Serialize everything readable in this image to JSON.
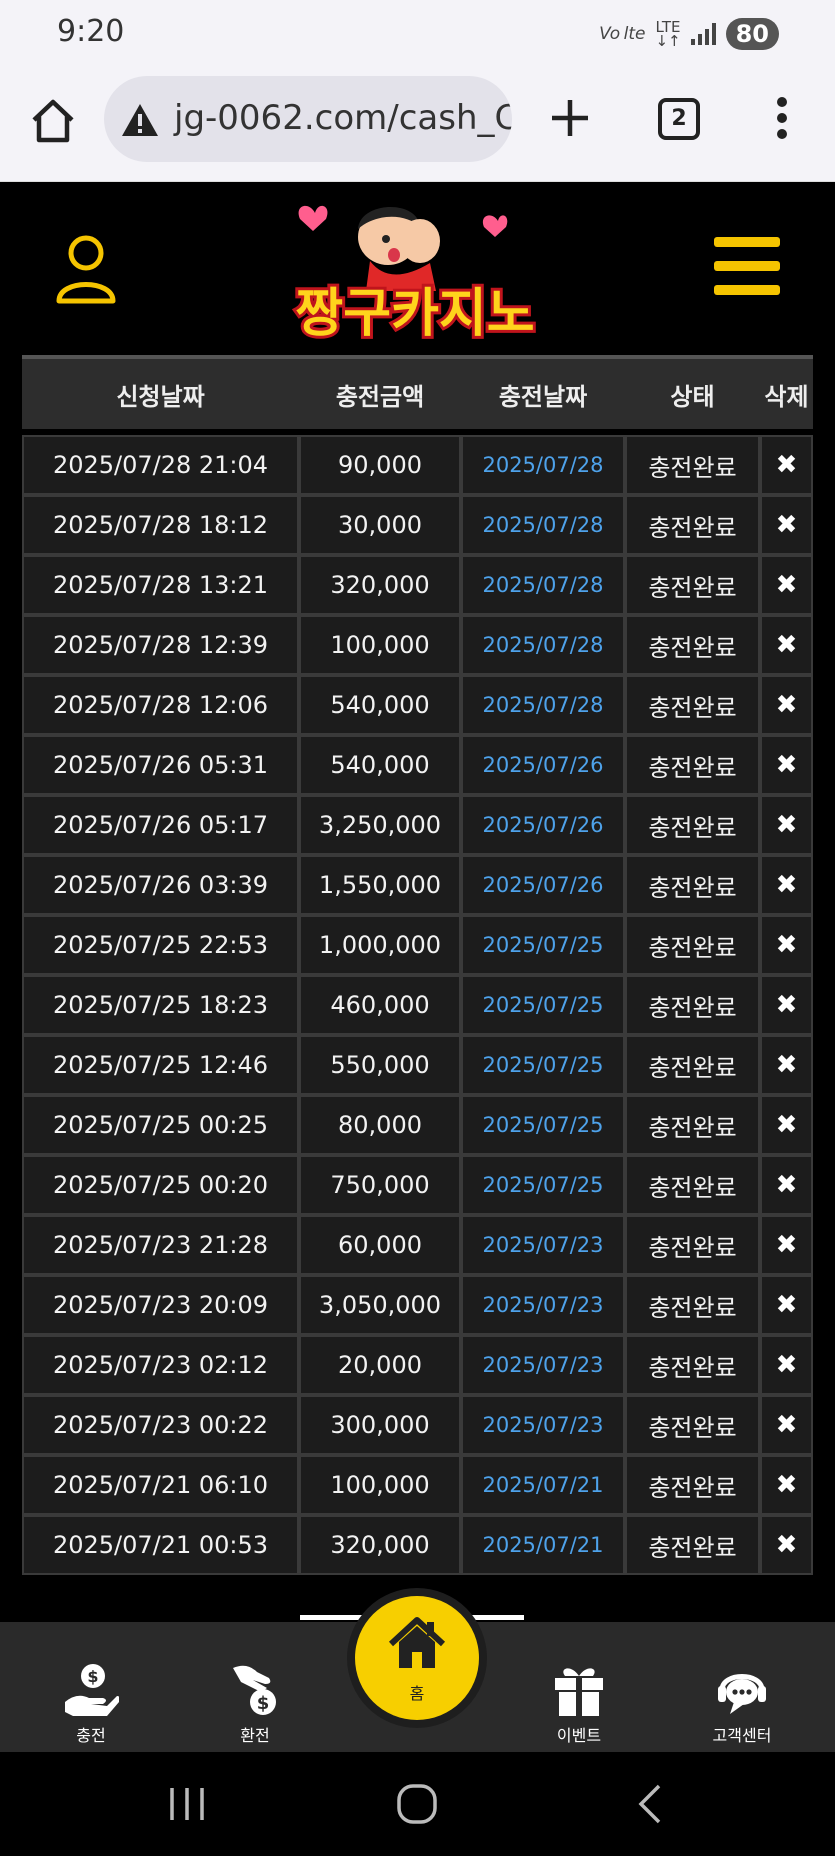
{
  "status_bar": {
    "time": "9:20",
    "volte": "Vo lte",
    "lte": "LTE",
    "battery": "80"
  },
  "browser": {
    "url": "jg-0062.com/cash_C",
    "tab_count": "2"
  },
  "site": {
    "logo_text": "짱구카지노"
  },
  "table": {
    "headers": {
      "request_date": "신청날짜",
      "amount": "충전금액",
      "charge_date": "충전날짜",
      "status": "상태",
      "delete": "삭제"
    },
    "delete_glyph": "✖",
    "rows": [
      {
        "request_date": "2025/07/28 21:04",
        "amount": "90,000",
        "charge_date": "2025/07/28",
        "status": "충전완료"
      },
      {
        "request_date": "2025/07/28 18:12",
        "amount": "30,000",
        "charge_date": "2025/07/28",
        "status": "충전완료"
      },
      {
        "request_date": "2025/07/28 13:21",
        "amount": "320,000",
        "charge_date": "2025/07/28",
        "status": "충전완료"
      },
      {
        "request_date": "2025/07/28 12:39",
        "amount": "100,000",
        "charge_date": "2025/07/28",
        "status": "충전완료"
      },
      {
        "request_date": "2025/07/28 12:06",
        "amount": "540,000",
        "charge_date": "2025/07/28",
        "status": "충전완료"
      },
      {
        "request_date": "2025/07/26 05:31",
        "amount": "540,000",
        "charge_date": "2025/07/26",
        "status": "충전완료"
      },
      {
        "request_date": "2025/07/26 05:17",
        "amount": "3,250,000",
        "charge_date": "2025/07/26",
        "status": "충전완료"
      },
      {
        "request_date": "2025/07/26 03:39",
        "amount": "1,550,000",
        "charge_date": "2025/07/26",
        "status": "충전완료"
      },
      {
        "request_date": "2025/07/25 22:53",
        "amount": "1,000,000",
        "charge_date": "2025/07/25",
        "status": "충전완료"
      },
      {
        "request_date": "2025/07/25 18:23",
        "amount": "460,000",
        "charge_date": "2025/07/25",
        "status": "충전완료"
      },
      {
        "request_date": "2025/07/25 12:46",
        "amount": "550,000",
        "charge_date": "2025/07/25",
        "status": "충전완료"
      },
      {
        "request_date": "2025/07/25 00:25",
        "amount": "80,000",
        "charge_date": "2025/07/25",
        "status": "충전완료"
      },
      {
        "request_date": "2025/07/25 00:20",
        "amount": "750,000",
        "charge_date": "2025/07/25",
        "status": "충전완료"
      },
      {
        "request_date": "2025/07/23 21:28",
        "amount": "60,000",
        "charge_date": "2025/07/23",
        "status": "충전완료"
      },
      {
        "request_date": "2025/07/23 20:09",
        "amount": "3,050,000",
        "charge_date": "2025/07/23",
        "status": "충전완료"
      },
      {
        "request_date": "2025/07/23 02:12",
        "amount": "20,000",
        "charge_date": "2025/07/23",
        "status": "충전완료"
      },
      {
        "request_date": "2025/07/23 00:22",
        "amount": "300,000",
        "charge_date": "2025/07/23",
        "status": "충전완료"
      },
      {
        "request_date": "2025/07/21 06:10",
        "amount": "100,000",
        "charge_date": "2025/07/21",
        "status": "충전완료"
      },
      {
        "request_date": "2025/07/21 00:53",
        "amount": "320,000",
        "charge_date": "2025/07/21",
        "status": "충전완료"
      }
    ]
  },
  "bottom_nav": {
    "charge": "충전",
    "exchange": "환전",
    "home": "홈",
    "event": "이벤트",
    "support": "고객센터"
  },
  "icons": {
    "user": "user-icon",
    "menu": "hamburger-menu-icon",
    "home": "house-icon",
    "charge": "hand-dollar-icon",
    "exchange": "hand-coin-icon",
    "event": "gift-icon",
    "support": "headset-chat-icon"
  },
  "colors": {
    "accent_yellow": "#f5c400",
    "date_blue": "#4ea2ea",
    "row_bg": "#1c1c1c",
    "nav_bg": "#2a2a2a"
  }
}
